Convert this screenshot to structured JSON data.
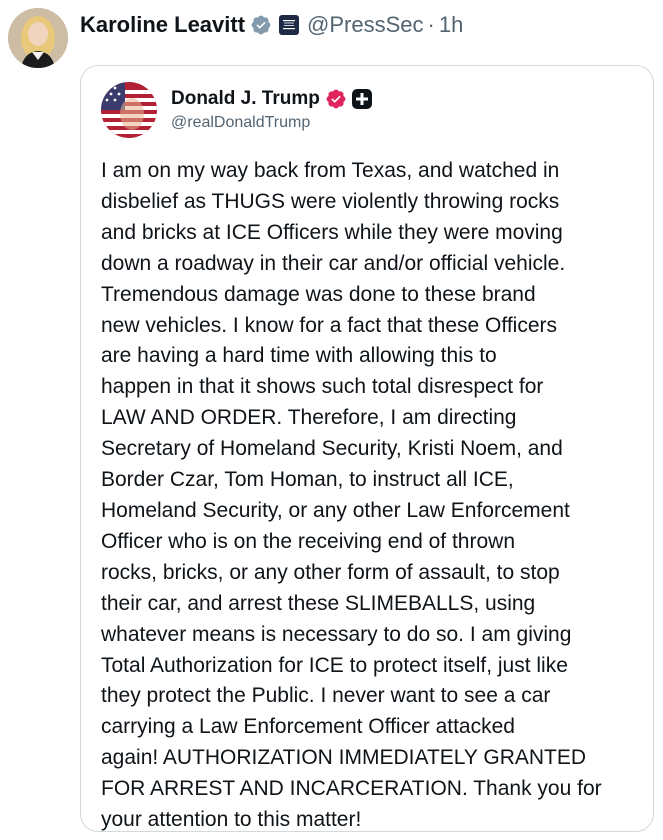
{
  "post": {
    "author_name": "Karoline Leavitt",
    "author_handle": "@PressSec",
    "separator": "·",
    "timestamp": "1h",
    "avatar_icon": "person-photo-avatar",
    "verified_icon": "verified-checkmark-icon",
    "affiliation_icon": "white-house-badge-icon"
  },
  "quoted_post": {
    "author_name": "Donald J. Trump",
    "author_handle": "@realDonaldTrump",
    "avatar_icon": "american-flag-portrait-avatar",
    "verified_icon": "verified-checkmark-icon",
    "plus_icon": "plus-square-icon",
    "body_lines": [
      "I am on my way back from Texas, and watched in",
      "disbelief as THUGS were violently throwing rocks",
      "and bricks at ICE Officers while they were moving",
      "down a roadway in their car and/or official vehicle.",
      "Tremendous damage was done to these brand",
      "new vehicles. I know for a fact that these Officers",
      "are having a hard time with allowing this to",
      "happen in that it shows such total disrespect for",
      "LAW AND ORDER. Therefore, I am directing",
      "Secretary of Homeland Security, Kristi Noem, and",
      "Border Czar, Tom Homan, to instruct all ICE,",
      "Homeland Security, or any other Law Enforcement",
      "Officer who is on the receiving end of thrown",
      "rocks, bricks, or any other form of assault, to stop",
      "their car, and arrest these SLIMEBALLS, using",
      "whatever means is necessary to do so. I am giving",
      "Total Authorization for ICE to protect itself, just like",
      "they protect the Public. I never want to see a car",
      "carrying a Law Enforcement Officer attacked",
      "again! AUTHORIZATION IMMEDIATELY GRANTED",
      "FOR ARREST AND INCARCERATION. Thank you for",
      "your attention to this matter!"
    ]
  },
  "colors": {
    "text_primary": "#0f1419",
    "text_secondary": "#536471",
    "verified_gray": "#829aab",
    "verified_pink": "#e0245e",
    "card_border": "#cfd9de"
  }
}
